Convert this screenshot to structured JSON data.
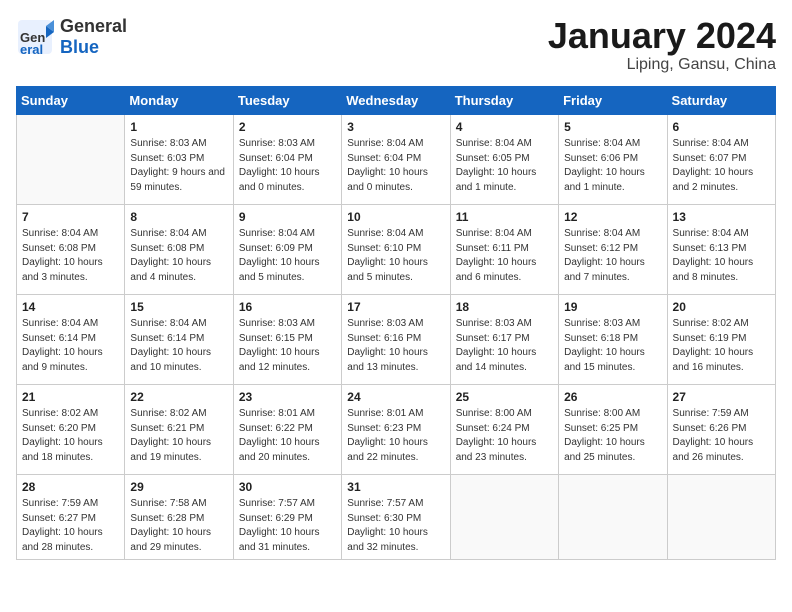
{
  "header": {
    "logo_general": "General",
    "logo_blue": "Blue",
    "month_title": "January 2024",
    "location": "Liping, Gansu, China"
  },
  "weekdays": [
    "Sunday",
    "Monday",
    "Tuesday",
    "Wednesday",
    "Thursday",
    "Friday",
    "Saturday"
  ],
  "weeks": [
    [
      {
        "day": "",
        "info": ""
      },
      {
        "day": "1",
        "info": "Sunrise: 8:03 AM\nSunset: 6:03 PM\nDaylight: 9 hours\nand 59 minutes."
      },
      {
        "day": "2",
        "info": "Sunrise: 8:03 AM\nSunset: 6:04 PM\nDaylight: 10 hours\nand 0 minutes."
      },
      {
        "day": "3",
        "info": "Sunrise: 8:04 AM\nSunset: 6:04 PM\nDaylight: 10 hours\nand 0 minutes."
      },
      {
        "day": "4",
        "info": "Sunrise: 8:04 AM\nSunset: 6:05 PM\nDaylight: 10 hours\nand 1 minute."
      },
      {
        "day": "5",
        "info": "Sunrise: 8:04 AM\nSunset: 6:06 PM\nDaylight: 10 hours\nand 1 minute."
      },
      {
        "day": "6",
        "info": "Sunrise: 8:04 AM\nSunset: 6:07 PM\nDaylight: 10 hours\nand 2 minutes."
      }
    ],
    [
      {
        "day": "7",
        "info": "Sunrise: 8:04 AM\nSunset: 6:08 PM\nDaylight: 10 hours\nand 3 minutes."
      },
      {
        "day": "8",
        "info": "Sunrise: 8:04 AM\nSunset: 6:08 PM\nDaylight: 10 hours\nand 4 minutes."
      },
      {
        "day": "9",
        "info": "Sunrise: 8:04 AM\nSunset: 6:09 PM\nDaylight: 10 hours\nand 5 minutes."
      },
      {
        "day": "10",
        "info": "Sunrise: 8:04 AM\nSunset: 6:10 PM\nDaylight: 10 hours\nand 5 minutes."
      },
      {
        "day": "11",
        "info": "Sunrise: 8:04 AM\nSunset: 6:11 PM\nDaylight: 10 hours\nand 6 minutes."
      },
      {
        "day": "12",
        "info": "Sunrise: 8:04 AM\nSunset: 6:12 PM\nDaylight: 10 hours\nand 7 minutes."
      },
      {
        "day": "13",
        "info": "Sunrise: 8:04 AM\nSunset: 6:13 PM\nDaylight: 10 hours\nand 8 minutes."
      }
    ],
    [
      {
        "day": "14",
        "info": "Sunrise: 8:04 AM\nSunset: 6:14 PM\nDaylight: 10 hours\nand 9 minutes."
      },
      {
        "day": "15",
        "info": "Sunrise: 8:04 AM\nSunset: 6:14 PM\nDaylight: 10 hours\nand 10 minutes."
      },
      {
        "day": "16",
        "info": "Sunrise: 8:03 AM\nSunset: 6:15 PM\nDaylight: 10 hours\nand 12 minutes."
      },
      {
        "day": "17",
        "info": "Sunrise: 8:03 AM\nSunset: 6:16 PM\nDaylight: 10 hours\nand 13 minutes."
      },
      {
        "day": "18",
        "info": "Sunrise: 8:03 AM\nSunset: 6:17 PM\nDaylight: 10 hours\nand 14 minutes."
      },
      {
        "day": "19",
        "info": "Sunrise: 8:03 AM\nSunset: 6:18 PM\nDaylight: 10 hours\nand 15 minutes."
      },
      {
        "day": "20",
        "info": "Sunrise: 8:02 AM\nSunset: 6:19 PM\nDaylight: 10 hours\nand 16 minutes."
      }
    ],
    [
      {
        "day": "21",
        "info": "Sunrise: 8:02 AM\nSunset: 6:20 PM\nDaylight: 10 hours\nand 18 minutes."
      },
      {
        "day": "22",
        "info": "Sunrise: 8:02 AM\nSunset: 6:21 PM\nDaylight: 10 hours\nand 19 minutes."
      },
      {
        "day": "23",
        "info": "Sunrise: 8:01 AM\nSunset: 6:22 PM\nDaylight: 10 hours\nand 20 minutes."
      },
      {
        "day": "24",
        "info": "Sunrise: 8:01 AM\nSunset: 6:23 PM\nDaylight: 10 hours\nand 22 minutes."
      },
      {
        "day": "25",
        "info": "Sunrise: 8:00 AM\nSunset: 6:24 PM\nDaylight: 10 hours\nand 23 minutes."
      },
      {
        "day": "26",
        "info": "Sunrise: 8:00 AM\nSunset: 6:25 PM\nDaylight: 10 hours\nand 25 minutes."
      },
      {
        "day": "27",
        "info": "Sunrise: 7:59 AM\nSunset: 6:26 PM\nDaylight: 10 hours\nand 26 minutes."
      }
    ],
    [
      {
        "day": "28",
        "info": "Sunrise: 7:59 AM\nSunset: 6:27 PM\nDaylight: 10 hours\nand 28 minutes."
      },
      {
        "day": "29",
        "info": "Sunrise: 7:58 AM\nSunset: 6:28 PM\nDaylight: 10 hours\nand 29 minutes."
      },
      {
        "day": "30",
        "info": "Sunrise: 7:57 AM\nSunset: 6:29 PM\nDaylight: 10 hours\nand 31 minutes."
      },
      {
        "day": "31",
        "info": "Sunrise: 7:57 AM\nSunset: 6:30 PM\nDaylight: 10 hours\nand 32 minutes."
      },
      {
        "day": "",
        "info": ""
      },
      {
        "day": "",
        "info": ""
      },
      {
        "day": "",
        "info": ""
      }
    ]
  ]
}
